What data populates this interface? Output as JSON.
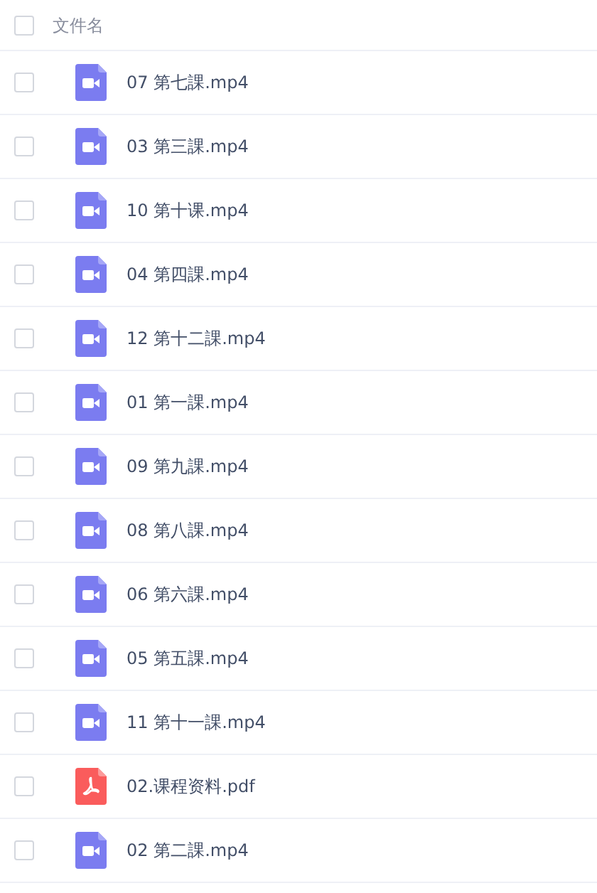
{
  "header": {
    "checked": false,
    "column_label": "文件名"
  },
  "files": [
    {
      "name": "07 第七課.mp4",
      "kind": "video",
      "checked": false
    },
    {
      "name": "03 第三課.mp4",
      "kind": "video",
      "checked": false
    },
    {
      "name": "10 第十课.mp4",
      "kind": "video",
      "checked": false
    },
    {
      "name": "04 第四課.mp4",
      "kind": "video",
      "checked": false
    },
    {
      "name": "12 第十二課.mp4",
      "kind": "video",
      "checked": false
    },
    {
      "name": "01 第一課.mp4",
      "kind": "video",
      "checked": false
    },
    {
      "name": "09 第九課.mp4",
      "kind": "video",
      "checked": false
    },
    {
      "name": "08 第八課.mp4",
      "kind": "video",
      "checked": false
    },
    {
      "name": "06 第六課.mp4",
      "kind": "video",
      "checked": false
    },
    {
      "name": "05 第五課.mp4",
      "kind": "video",
      "checked": false
    },
    {
      "name": "11 第十一課.mp4",
      "kind": "video",
      "checked": false
    },
    {
      "name": "02.课程资料.pdf",
      "kind": "pdf",
      "checked": false
    },
    {
      "name": "02 第二課.mp4",
      "kind": "video",
      "checked": false
    }
  ]
}
